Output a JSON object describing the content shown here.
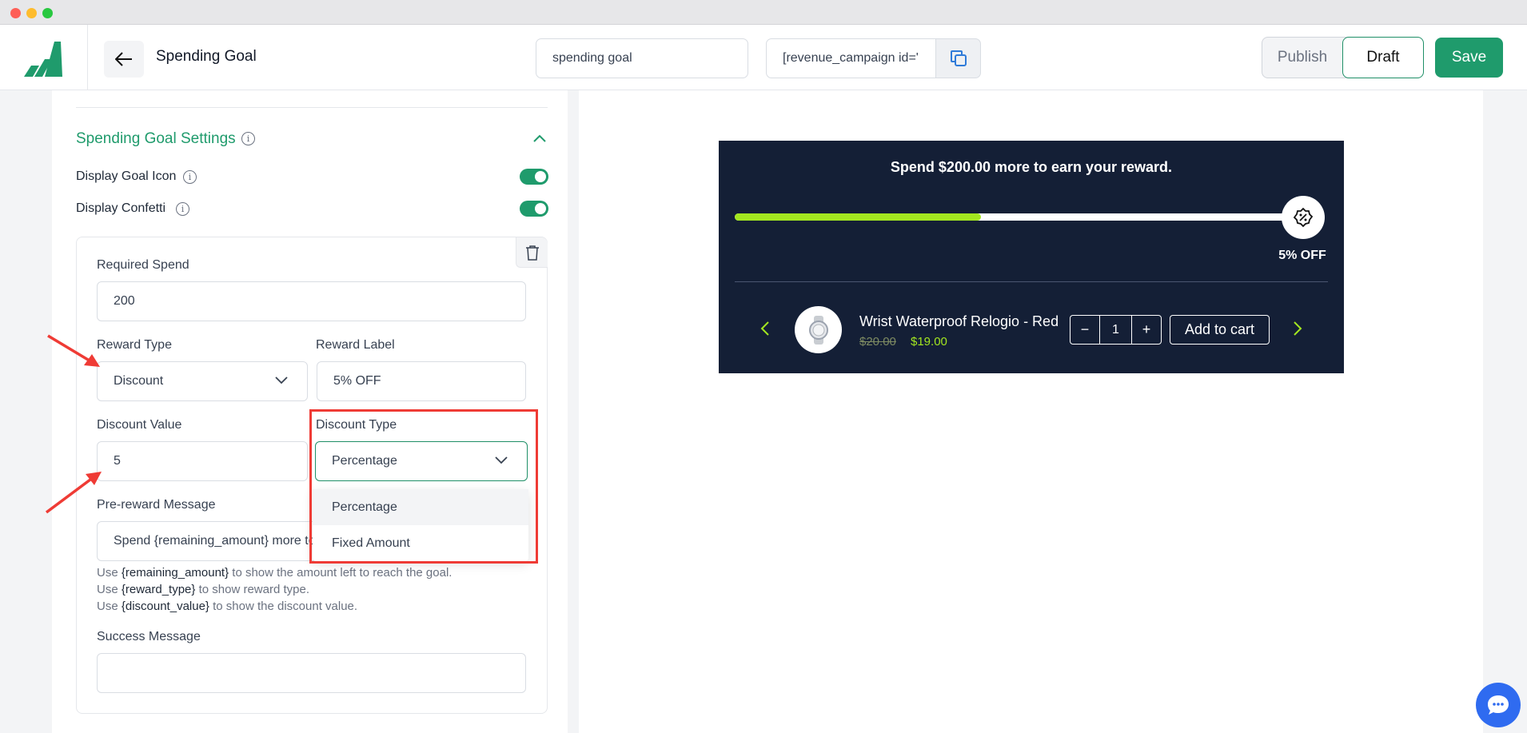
{
  "header": {
    "title": "Spending Goal",
    "campaign_name": "spending goal",
    "shortcode": "[revenue_campaign id='",
    "publish_label": "Publish",
    "draft_label": "Draft",
    "save_label": "Save"
  },
  "settings": {
    "section_title": "Spending Goal Settings",
    "display_goal_icon_label": "Display Goal Icon",
    "display_goal_icon_on": true,
    "display_confetti_label": "Display Confetti",
    "display_confetti_on": true
  },
  "goal_card": {
    "required_spend_label": "Required Spend",
    "required_spend_value": "200",
    "reward_type_label": "Reward Type",
    "reward_type_value": "Discount",
    "reward_label_label": "Reward Label",
    "reward_label_value": "5% OFF",
    "discount_value_label": "Discount Value",
    "discount_value_value": "5",
    "discount_type_label": "Discount Type",
    "discount_type_value": "Percentage",
    "discount_type_options": [
      "Percentage",
      "Fixed Amount"
    ],
    "pre_reward_label": "Pre-reward Message",
    "pre_reward_value": "Spend {remaining_amount} more to",
    "hints": [
      {
        "code": "{remaining_amount}",
        "text": " to show the amount left to reach the goal."
      },
      {
        "code": "{reward_type}",
        "text": " to show reward type."
      },
      {
        "code": "{discount_value}",
        "text": " to show the discount value."
      }
    ],
    "hint_prefix": "Use ",
    "success_label": "Success Message",
    "success_value": ""
  },
  "preview": {
    "message": "Spend $200.00 more to earn your reward.",
    "progress": 0.44,
    "goal_label": "5% OFF",
    "product_name": "Wrist Waterproof Relogio - Red",
    "old_price": "$20.00",
    "new_price": "$19.00",
    "quantity": "1",
    "minus": "−",
    "plus": "+",
    "add_to_cart": "Add to cart"
  },
  "colors": {
    "brand": "#1f9b6c",
    "progress": "#a3e620",
    "widget_bg": "#141f36",
    "annotation": "#ef3b35"
  }
}
